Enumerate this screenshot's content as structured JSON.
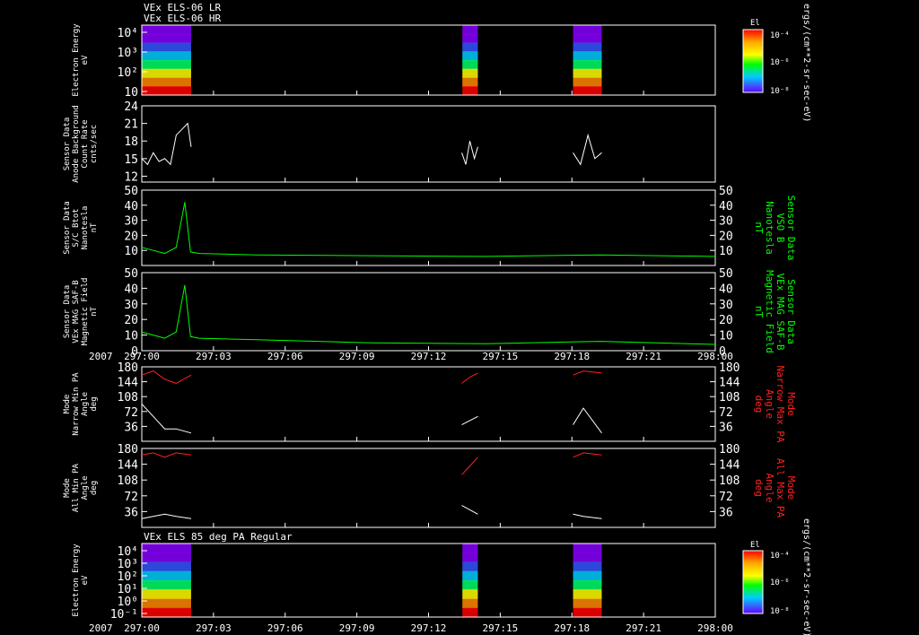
{
  "header": {
    "line1": "VEx ELS-06 LR",
    "line2": "VEx ELS-06 HR"
  },
  "title_bottom": "VEx ELS 85 deg PA Regular",
  "colors": {
    "white": "#ffffff",
    "green": "#00ff00",
    "red": "#ff2020"
  },
  "time_axis": {
    "year": "2007",
    "ticks": [
      "297:00",
      "297:03",
      "297:06",
      "297:09",
      "297:12",
      "297:15",
      "297:18",
      "297:21",
      "298:00"
    ]
  },
  "colorbar": {
    "title": "El",
    "ticks": [
      "10⁻⁴",
      "10⁻⁶",
      "10⁻⁸"
    ],
    "unit": "ergs/(cm**2-sr-sec-eV)"
  },
  "panels": [
    {
      "id": "energy-top",
      "type": "spectrogram",
      "ylabel": [
        "Electron Energy",
        "eV"
      ],
      "yticks": [
        "10⁴",
        "10³",
        "10²",
        "10"
      ],
      "data_blocks": [
        [
          0.0,
          0.086
        ],
        [
          0.559,
          0.586
        ],
        [
          0.752,
          0.802
        ]
      ]
    },
    {
      "id": "anode-bg",
      "type": "line",
      "color": "white",
      "ylabel": [
        "Sensor Data",
        "Anode Background",
        "Count Rate",
        "cnts/sec"
      ],
      "ylim": [
        11,
        24
      ],
      "yticks": [
        24,
        21,
        18,
        15,
        12
      ],
      "segments": [
        {
          "x": [
            0.0,
            0.01,
            0.02,
            0.03,
            0.04,
            0.05,
            0.06,
            0.07,
            0.08,
            0.086
          ],
          "y": [
            15,
            14,
            16,
            14.5,
            15,
            14,
            19,
            20,
            21,
            17
          ]
        },
        {
          "x": [
            0.558,
            0.565,
            0.572,
            0.58,
            0.586
          ],
          "y": [
            16,
            14,
            18,
            15,
            17
          ]
        },
        {
          "x": [
            0.752,
            0.765,
            0.778,
            0.79,
            0.802
          ],
          "y": [
            16,
            14,
            19,
            15,
            16
          ]
        }
      ]
    },
    {
      "id": "sc-btot",
      "type": "line",
      "color": "green",
      "ylabel": [
        "Sensor Data",
        "S/C Btot",
        "Nanotesla",
        "nT"
      ],
      "right_label": [
        "Sensor Data",
        "VSO B",
        "Nanotesla",
        "nT"
      ],
      "ylim": [
        0,
        50
      ],
      "yticks": [
        50,
        40,
        30,
        20,
        10
      ],
      "segments": [
        {
          "x": [
            0.0,
            0.02,
            0.04,
            0.06,
            0.075,
            0.085,
            0.1,
            0.2,
            0.4,
            0.6,
            0.8,
            1.0
          ],
          "y": [
            12,
            10,
            8,
            12,
            42,
            9,
            8,
            7,
            6.5,
            6,
            7,
            6
          ]
        }
      ]
    },
    {
      "id": "mag-saf",
      "type": "line",
      "color": "green",
      "ylabel": [
        "Sensor Data",
        "VEx MAG SAF-B",
        "Magnetic Field",
        "nT"
      ],
      "right_label": [
        "Sensor Data",
        "VEx MAG SAF-B",
        "Magnetic Field",
        "nT"
      ],
      "ylim": [
        0,
        50
      ],
      "yticks": [
        50,
        40,
        30,
        20,
        10,
        0
      ],
      "segments": [
        {
          "x": [
            0.0,
            0.02,
            0.04,
            0.06,
            0.075,
            0.085,
            0.1,
            0.2,
            0.4,
            0.6,
            0.8,
            1.0
          ],
          "y": [
            12,
            10,
            8,
            12,
            42,
            9,
            8,
            7,
            5,
            4.5,
            6,
            4
          ]
        }
      ]
    },
    {
      "id": "narrow-pa",
      "type": "line2",
      "ylabel": [
        "Mode",
        "Narrow Min PA",
        "Angle",
        "deg"
      ],
      "right_label": [
        "Mode",
        "Narrow Max PA",
        "Angle",
        "deg"
      ],
      "ylim": [
        0,
        180
      ],
      "yticks": [
        180,
        144,
        108,
        72,
        36
      ],
      "white_segments": [
        {
          "x": [
            0.0,
            0.02,
            0.04,
            0.06,
            0.086
          ],
          "y": [
            90,
            60,
            30,
            30,
            20
          ]
        },
        {
          "x": [
            0.558,
            0.572,
            0.586
          ],
          "y": [
            40,
            50,
            60
          ]
        },
        {
          "x": [
            0.752,
            0.77,
            0.802
          ],
          "y": [
            40,
            80,
            20
          ]
        }
      ],
      "red_segments": [
        {
          "x": [
            0.0,
            0.02,
            0.04,
            0.06,
            0.086
          ],
          "y": [
            160,
            170,
            150,
            140,
            160
          ]
        },
        {
          "x": [
            0.558,
            0.572,
            0.586
          ],
          "y": [
            140,
            155,
            165
          ]
        },
        {
          "x": [
            0.752,
            0.77,
            0.802
          ],
          "y": [
            160,
            170,
            165
          ]
        }
      ]
    },
    {
      "id": "all-pa",
      "type": "line2",
      "ylabel": [
        "Mode",
        "All Min PA",
        "Angle",
        "deg"
      ],
      "right_label": [
        "Mode",
        "All Max PA",
        "Angle",
        "deg"
      ],
      "ylim": [
        0,
        180
      ],
      "yticks": [
        180,
        144,
        108,
        72,
        36
      ],
      "white_segments": [
        {
          "x": [
            0.0,
            0.02,
            0.04,
            0.06,
            0.086
          ],
          "y": [
            20,
            25,
            30,
            25,
            20
          ]
        },
        {
          "x": [
            0.558,
            0.572,
            0.586
          ],
          "y": [
            50,
            40,
            30
          ]
        },
        {
          "x": [
            0.752,
            0.77,
            0.802
          ],
          "y": [
            30,
            25,
            20
          ]
        }
      ],
      "red_segments": [
        {
          "x": [
            0.0,
            0.02,
            0.04,
            0.06,
            0.086
          ],
          "y": [
            165,
            170,
            160,
            170,
            165
          ]
        },
        {
          "x": [
            0.558,
            0.572,
            0.586
          ],
          "y": [
            120,
            140,
            160
          ]
        },
        {
          "x": [
            0.752,
            0.77,
            0.802
          ],
          "y": [
            160,
            170,
            165
          ]
        }
      ]
    },
    {
      "id": "energy-bottom",
      "type": "spectrogram",
      "ylabel": [
        "Electron Energy",
        "eV"
      ],
      "yticks": [
        "10⁴",
        "10³",
        "10²",
        "10¹",
        "10⁰",
        "10⁻¹"
      ],
      "data_blocks": [
        [
          0.0,
          0.086
        ],
        [
          0.559,
          0.586
        ],
        [
          0.752,
          0.802
        ]
      ]
    }
  ]
}
